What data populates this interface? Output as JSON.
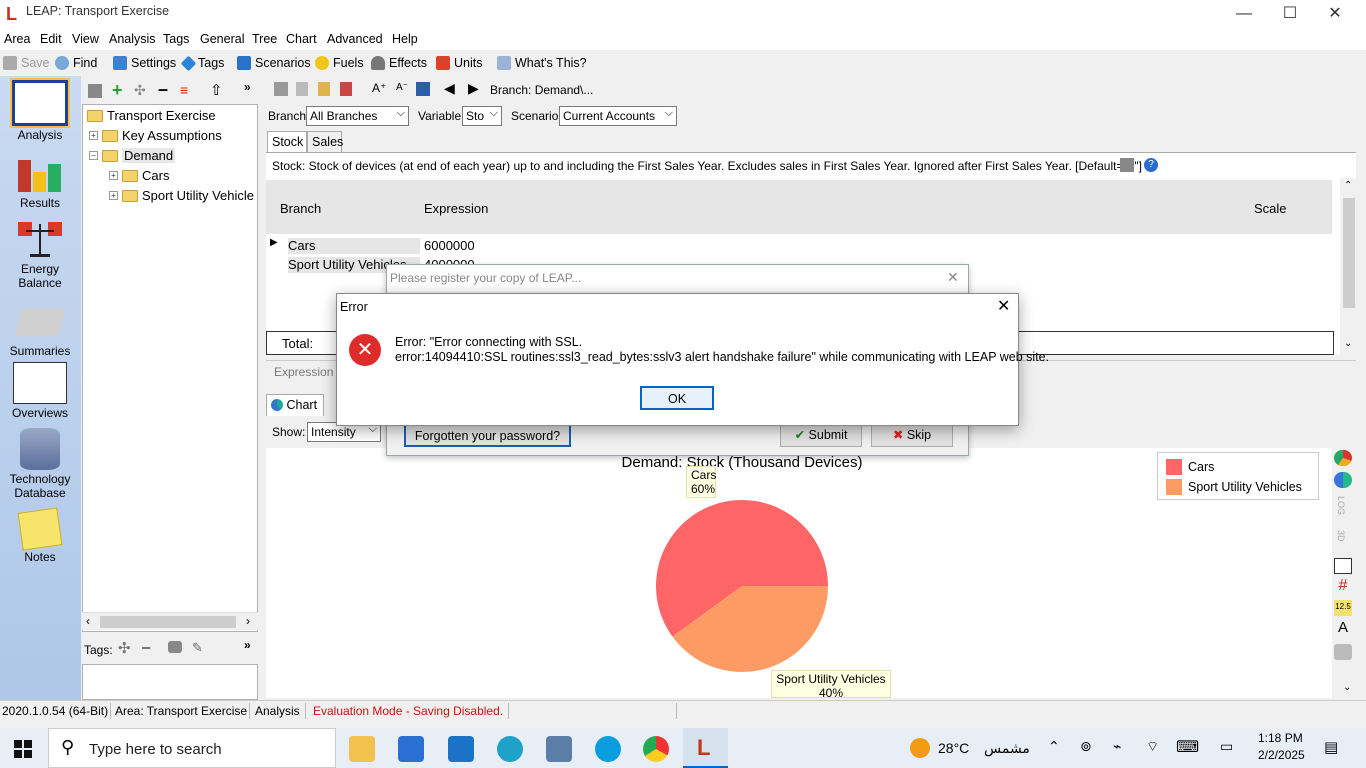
{
  "window": {
    "title": "LEAP: Transport Exercise",
    "min_glyph": "—",
    "max_glyph": "☐",
    "close_glyph": "✕"
  },
  "menu": [
    "Area",
    "Edit",
    "View",
    "Analysis",
    "Tags",
    "General",
    "Tree",
    "Chart",
    "Advanced",
    "Help"
  ],
  "toolbar": {
    "save": "Save",
    "find": "Find",
    "settings": "Settings",
    "tags": "Tags",
    "scenarios": "Scenarios",
    "fuels": "Fuels",
    "effects": "Effects",
    "units": "Units",
    "whats_this": "What's This?"
  },
  "leftbar": [
    "Analysis",
    "Results",
    "Energy Balance",
    "Summaries",
    "Overviews",
    "Technology Database",
    "Notes"
  ],
  "tree": {
    "root": "Transport Exercise",
    "items": [
      "Key Assumptions",
      "Demand",
      "Cars",
      "Sport Utility Vehicle"
    ]
  },
  "tags_label": "Tags:",
  "branch_path": "Branch: Demand\\...",
  "selectors": {
    "branch_label": "Branch:",
    "branch_value": "All Branches",
    "variable_label": "Variable:",
    "variable_value": "Sto",
    "scenario_label": "Scenario:",
    "scenario_value": "Current Accounts"
  },
  "tabs": [
    "Stock",
    "Sales"
  ],
  "description": "Stock: Stock of devices (at end of each year) up to and including the First Sales Year.  Excludes sales in First Sales Year.  Ignored after First Sales Year. [Default=\"0\"]",
  "grid": {
    "col_branch": "Branch",
    "col_expression": "Expression",
    "col_scale": "Scale",
    "rows": [
      {
        "branch": "Cars",
        "expression": "6000000"
      },
      {
        "branch": "Sport Utility Vehicles",
        "expression": "4000000"
      }
    ],
    "total": "Total:"
  },
  "expression_label": "Expression",
  "chart_tab": "Chart",
  "show": {
    "label": "Show:",
    "value": "Intensity"
  },
  "register": {
    "title": "Please register your copy of LEAP...",
    "forgot": "Forgotten your password?",
    "submit": "Submit",
    "skip": "Skip"
  },
  "error": {
    "title": "Error",
    "line1": "Error: \"Error connecting with SSL.",
    "line2": "error:14094410:SSL routines:ssl3_read_bytes:sslv3 alert handshake failure\" while communicating with LEAP web site.",
    "ok": "OK"
  },
  "chart_data": {
    "type": "pie",
    "title": "Demand: Stock (Thousand Devices)",
    "categories": [
      "Cars",
      "Sport Utility Vehicles"
    ],
    "values": [
      60,
      40
    ],
    "labels": [
      {
        "name": "Cars",
        "pct": "60%"
      },
      {
        "name": "Sport Utility Vehicles",
        "pct": "40%"
      }
    ],
    "colors": [
      "#fd6566",
      "#fd9b64"
    ],
    "legend": "top-right"
  },
  "right_tools": {
    "log": "LOG",
    "three_d": "3D"
  },
  "status": {
    "version": "2020.1.0.54 (64-Bit)",
    "area": "Area: Transport Exercise",
    "view": "Analysis",
    "mode": "Evaluation Mode - Saving Disabled."
  },
  "taskbar": {
    "search": "Type here to search",
    "temp": "28°C",
    "weather": "مشمس",
    "time": "1:18 PM",
    "date": "2/2/2025"
  }
}
